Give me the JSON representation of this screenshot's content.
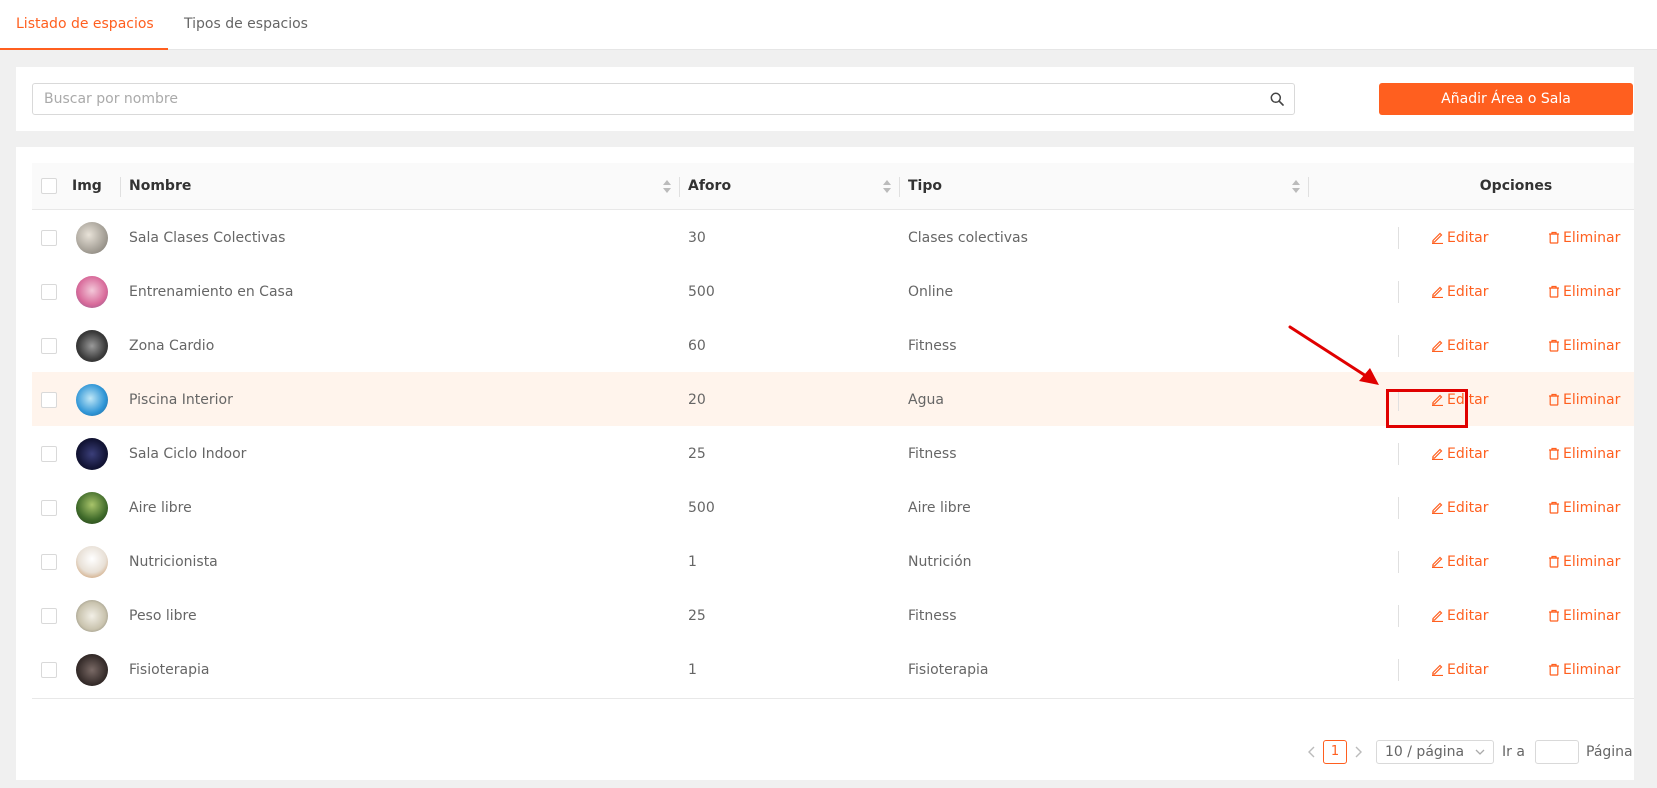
{
  "tabs": [
    {
      "label": "Listado de espacios",
      "active": true
    },
    {
      "label": "Tipos de espacios",
      "active": false
    }
  ],
  "search": {
    "placeholder": "Buscar por nombre"
  },
  "add_button": {
    "label": "Añadir Área o Sala"
  },
  "table": {
    "columns": {
      "img": "Img",
      "nombre": "Nombre",
      "aforo": "Aforo",
      "tipo": "Tipo",
      "opciones": "Opciones"
    },
    "edit_label": "Editar",
    "delete_label": "Eliminar",
    "rows": [
      {
        "nombre": "Sala Clases Colectivas",
        "aforo": "30",
        "tipo": "Clases colectivas"
      },
      {
        "nombre": "Entrenamiento en Casa",
        "aforo": "500",
        "tipo": "Online"
      },
      {
        "nombre": "Zona Cardio",
        "aforo": "60",
        "tipo": "Fitness"
      },
      {
        "nombre": "Piscina Interior",
        "aforo": "20",
        "tipo": "Agua"
      },
      {
        "nombre": "Sala Ciclo Indoor",
        "aforo": "25",
        "tipo": "Fitness"
      },
      {
        "nombre": "Aire libre",
        "aforo": "500",
        "tipo": "Aire libre"
      },
      {
        "nombre": "Nutricionista",
        "aforo": "1",
        "tipo": "Nutrición"
      },
      {
        "nombre": "Peso libre",
        "aforo": "25",
        "tipo": "Fitness"
      },
      {
        "nombre": "Fisioterapia",
        "aforo": "1",
        "tipo": "Fisioterapia"
      }
    ]
  },
  "pagination": {
    "current_page": "1",
    "page_size": "10 / página",
    "goto_label": "Ir a",
    "page_label": "Página"
  },
  "colors": {
    "accent": "#ff5f1f",
    "highlight_row": "#fff4ec",
    "annotation": "#e00000"
  }
}
